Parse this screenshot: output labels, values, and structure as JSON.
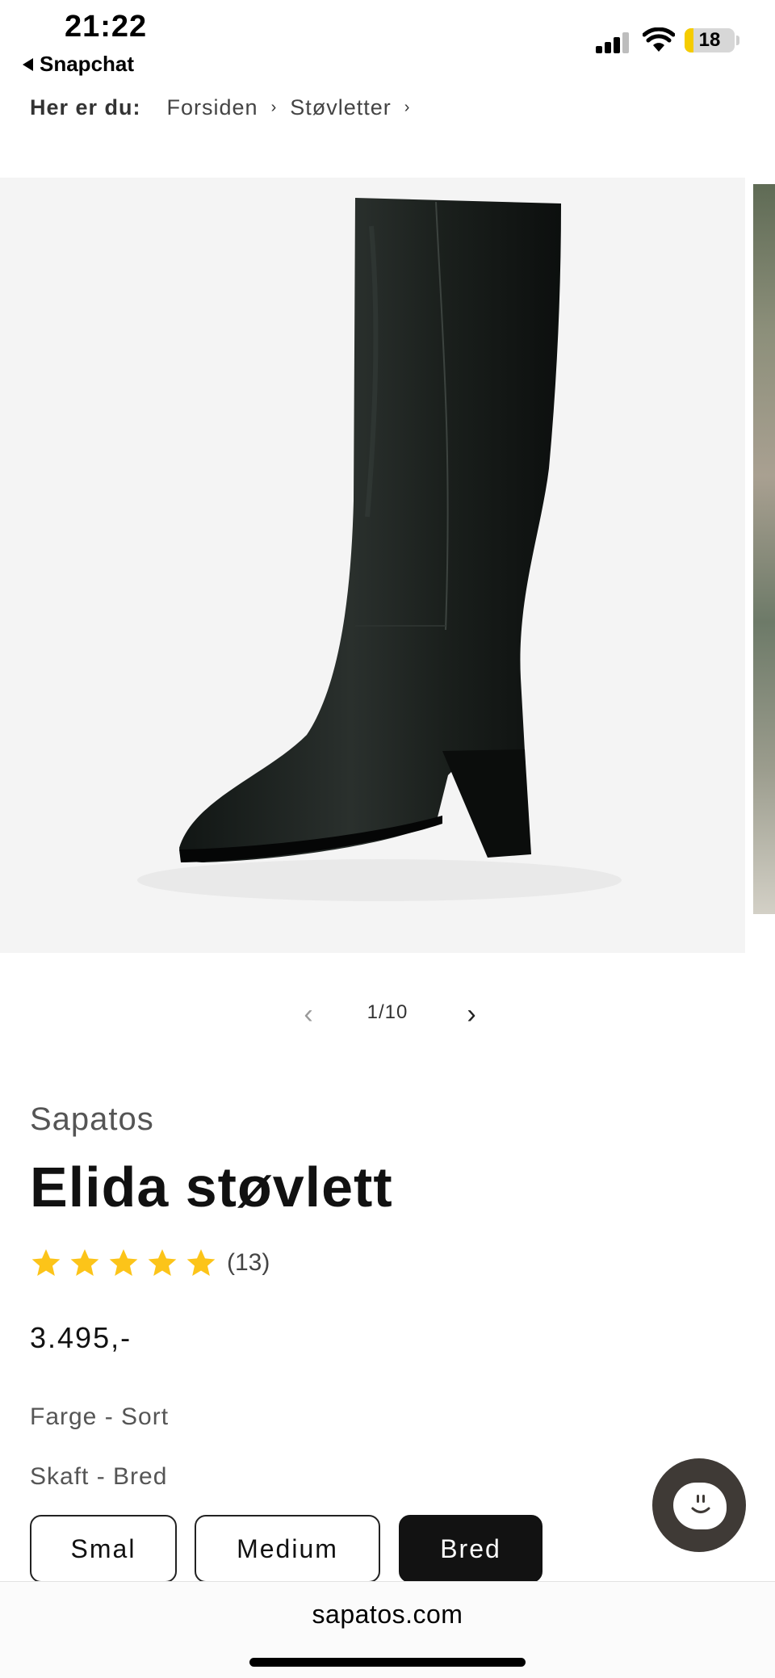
{
  "status_bar": {
    "time": "21:22",
    "back_app": "Snapchat",
    "battery_level": "18",
    "battery_fraction": 0.18,
    "signal_icon": "cellular-signal-icon",
    "wifi_icon": "wifi-icon"
  },
  "breadcrumb": {
    "lead": "Her er du:",
    "items": [
      "Forsiden",
      "Støvletter"
    ]
  },
  "gallery": {
    "current": 1,
    "total": 10,
    "counter": "1/10",
    "prev_icon": "chevron-left-icon",
    "next_icon": "chevron-right-icon"
  },
  "product": {
    "vendor": "Sapatos",
    "title": "Elida støvlett",
    "rating": 5,
    "review_count": "(13)",
    "price": "3.495,-",
    "color_label": "Farge - Sort",
    "shaft_label": "Skaft - Bred",
    "shaft_options": [
      "Smal",
      "Medium",
      "Bred"
    ],
    "selected_shaft": "Bred"
  },
  "colors": {
    "star": "#FCC419",
    "selected_button": "#121212",
    "chat_bubble": "#3F3A36"
  },
  "browser": {
    "url": "sapatos.com"
  }
}
